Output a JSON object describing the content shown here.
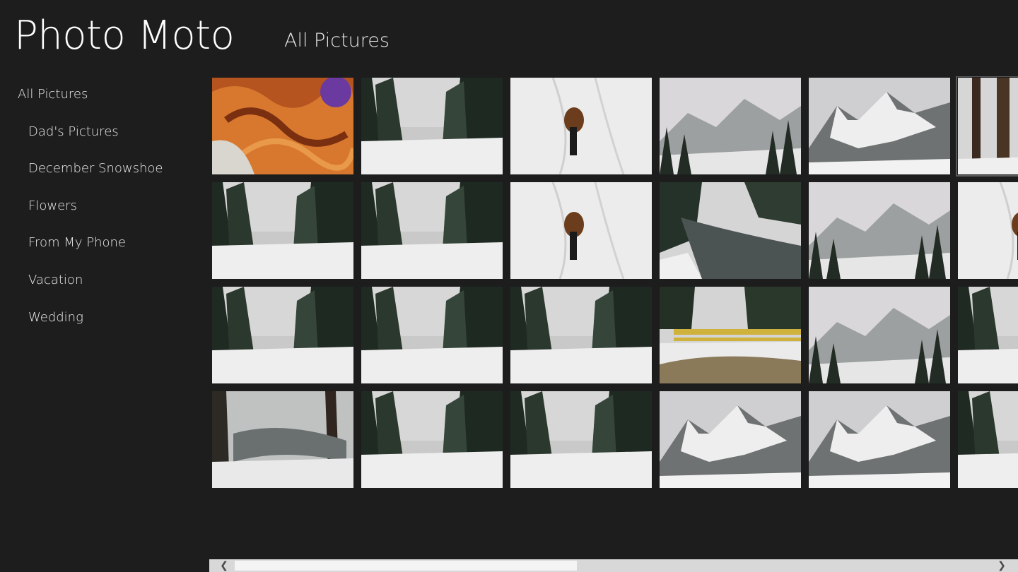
{
  "app": {
    "title": "Photo Moto"
  },
  "header": {
    "page_title": "All Pictures"
  },
  "sidebar": {
    "items": [
      {
        "label": "All Pictures"
      },
      {
        "label": "Dad's Pictures"
      },
      {
        "label": "December Snowshoe"
      },
      {
        "label": "Flowers"
      },
      {
        "label": "From My Phone"
      },
      {
        "label": "Vacation"
      },
      {
        "label": "Wedding"
      }
    ]
  },
  "gallery": {
    "rows": 4,
    "visible_columns": 6,
    "selected_tile": 5,
    "tiles": [
      {
        "scene": "dog-fur"
      },
      {
        "scene": "snowy-forest-road"
      },
      {
        "scene": "dog-snow-trail"
      },
      {
        "scene": "misty-mountain-forest"
      },
      {
        "scene": "snowy-mountain"
      },
      {
        "scene": "tall-trees-snow"
      },
      {
        "scene": "snowy-forest-road"
      },
      {
        "scene": "snowy-forest-road"
      },
      {
        "scene": "dog-snow-trail"
      },
      {
        "scene": "river-snow"
      },
      {
        "scene": "misty-mountain-forest"
      },
      {
        "scene": "dog-snow-trail"
      },
      {
        "scene": "snowy-forest-road"
      },
      {
        "scene": "snowy-forest-road"
      },
      {
        "scene": "snowy-forest-road"
      },
      {
        "scene": "snow-gate"
      },
      {
        "scene": "misty-mountain-forest"
      },
      {
        "scene": "snowy-forest-road"
      },
      {
        "scene": "snowy-creek"
      },
      {
        "scene": "snowy-forest-road"
      },
      {
        "scene": "snowy-forest-road"
      },
      {
        "scene": "snowy-mountain"
      },
      {
        "scene": "snowy-mountain"
      },
      {
        "scene": "snowy-forest-road"
      }
    ]
  },
  "scrollbar": {
    "left_icon": "chevron-left-icon",
    "right_icon": "chevron-right-icon",
    "position": 0.0,
    "visible_fraction": 0.42
  },
  "colors": {
    "background": "#1d1d1d",
    "text": "#ffffff",
    "scrollbar_track": "#d8d8d8",
    "scrollbar_thumb": "#f4f4f4"
  }
}
